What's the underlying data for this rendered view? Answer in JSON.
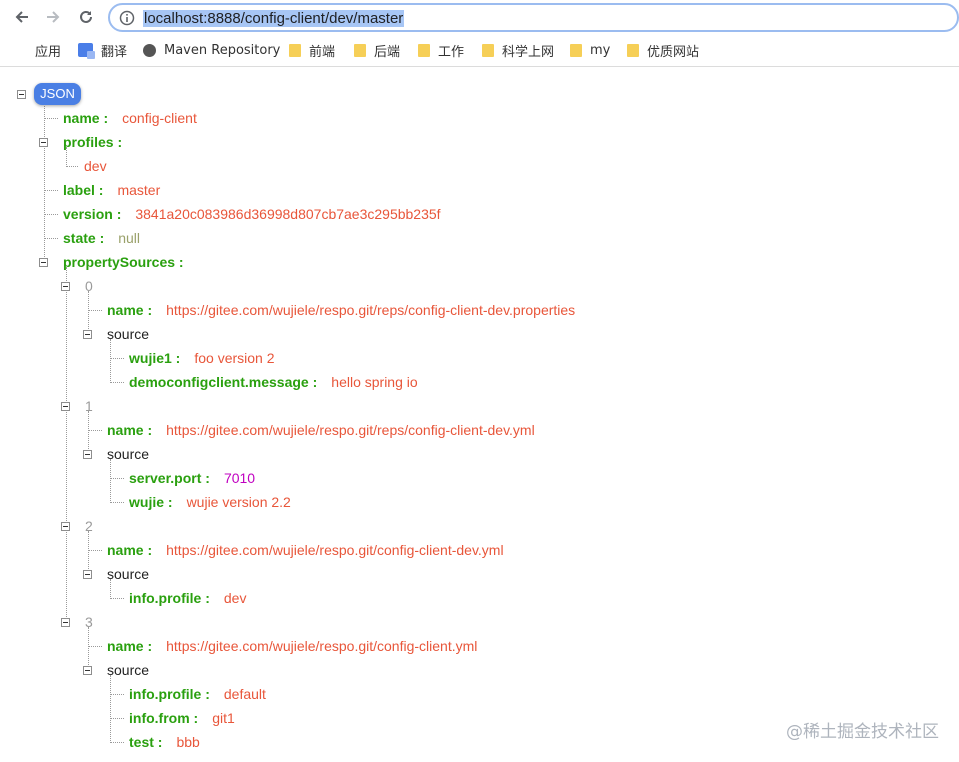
{
  "browser": {
    "url": "localhost:8888/config-client/dev/master",
    "bookmarks": [
      {
        "label": "应用",
        "icon": "apps-grid-icon"
      },
      {
        "label": "翻译",
        "icon": "translate-icon"
      },
      {
        "label": "Maven Repository",
        "icon": "globe-icon"
      },
      {
        "label": "前端",
        "icon": "folder-icon"
      },
      {
        "label": "后端",
        "icon": "folder-icon"
      },
      {
        "label": "工作",
        "icon": "folder-icon"
      },
      {
        "label": "科学上网",
        "icon": "folder-icon"
      },
      {
        "label": "my",
        "icon": "folder-icon"
      },
      {
        "label": "优质网站",
        "icon": "folder-icon"
      }
    ]
  },
  "json_view": {
    "badge": "JSON",
    "name": {
      "key": "name :",
      "value": "config-client"
    },
    "profiles": {
      "key": "profiles :",
      "items": [
        "dev"
      ]
    },
    "label": {
      "key": "label :",
      "value": "master"
    },
    "version": {
      "key": "version :",
      "value": "3841a20c083986d36998d807cb7ae3c295bb235f"
    },
    "state": {
      "key": "state :",
      "value": "null"
    },
    "propertySources": {
      "key": "propertySources :",
      "items": [
        {
          "index": "0",
          "name_key": "name :",
          "name": "https://gitee.com/wujiele/respo.git/reps/config-client-dev.properties",
          "source_label": "source",
          "source": [
            {
              "key": "wujie1 :",
              "value": "foo version 2"
            },
            {
              "key": "democonfigclient.message :",
              "value": "hello spring io"
            }
          ]
        },
        {
          "index": "1",
          "name_key": "name :",
          "name": "https://gitee.com/wujiele/respo.git/reps/config-client-dev.yml",
          "source_label": "source",
          "source": [
            {
              "key": "server.port :",
              "value": "7010"
            },
            {
              "key": "wujie :",
              "value": "wujie version 2.2"
            }
          ]
        },
        {
          "index": "2",
          "name_key": "name :",
          "name": "https://gitee.com/wujiele/respo.git/config-client-dev.yml",
          "source_label": "source",
          "source": [
            {
              "key": "info.profile :",
              "value": "dev"
            }
          ]
        },
        {
          "index": "3",
          "name_key": "name :",
          "name": "https://gitee.com/wujiele/respo.git/config-client.yml",
          "source_label": "source",
          "source": [
            {
              "key": "info.profile :",
              "value": "default"
            },
            {
              "key": "info.from :",
              "value": "git1"
            },
            {
              "key": "test :",
              "value": "bbb"
            }
          ]
        }
      ]
    }
  },
  "watermark": "@稀土掘金技术社区",
  "colors": {
    "key": "#2aa00f",
    "string": "#e8563a",
    "number": "#c000c0",
    "null": "#9aa16a",
    "badge": "#4a7fe4"
  }
}
